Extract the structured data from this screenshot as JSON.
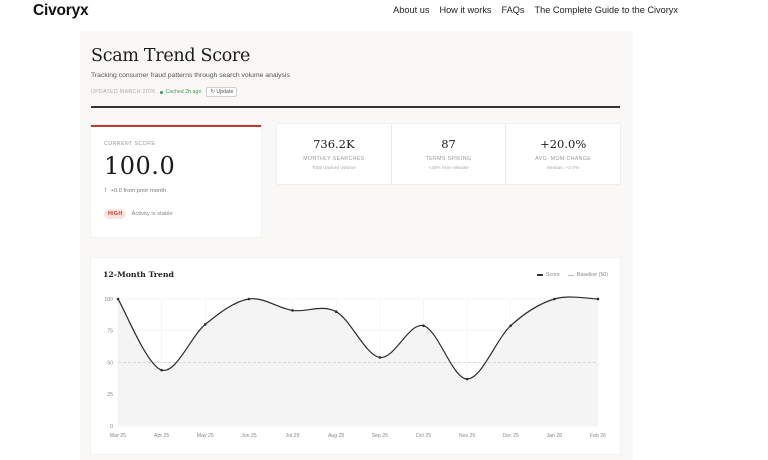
{
  "nav": {
    "logo": "Civoryx",
    "links": [
      "About us",
      "How it works",
      "FAQs",
      "The Complete Guide to the Civoryx"
    ]
  },
  "header": {
    "title": "Scam Trend Score",
    "subtitle": "Tracking consumer fraud patterns through search volume analysis",
    "updated": "UPDATED MARCH 2026",
    "cached": "Cached 2h ago",
    "update_label": "↻ Update"
  },
  "score_card": {
    "label": "CURRENT SCORE",
    "value": "100.0",
    "change": "+0.0 from prior month",
    "badge": "HIGH",
    "badge_note": "Activity is stable",
    "accent_color": "#c0392b"
  },
  "stats": [
    {
      "value": "736.2K",
      "label": "MONTHLY SEARCHES",
      "sub": "Total tracked volume"
    },
    {
      "value": "87",
      "label": "TERMS SPIKING",
      "sub": "+20% from release"
    },
    {
      "value": "+20.0%",
      "label": "AVG. MOM CHANGE",
      "sub": "Median: +2.0%"
    }
  ],
  "chart": {
    "title": "12-Month Trend",
    "legend_score": "Score",
    "legend_baseline": "Baseline (50)"
  },
  "chart_data": {
    "type": "line",
    "x": [
      "Mar 25",
      "Apr 25",
      "May 25",
      "Jun 25",
      "Jul 25",
      "Aug 25",
      "Sep 25",
      "Oct 25",
      "Nov 25",
      "Dec 25",
      "Jan 26",
      "Feb 26"
    ],
    "series": [
      {
        "name": "Score",
        "values": [
          100,
          44,
          80,
          100,
          91,
          90,
          54,
          79,
          37,
          79,
          100,
          100
        ]
      },
      {
        "name": "Baseline (50)",
        "values": [
          50,
          50,
          50,
          50,
          50,
          50,
          50,
          50,
          50,
          50,
          50,
          50
        ]
      }
    ],
    "yticks": [
      0,
      25,
      50,
      75,
      100
    ],
    "ylim": [
      0,
      100
    ],
    "grid": true,
    "legend": "top-right"
  }
}
